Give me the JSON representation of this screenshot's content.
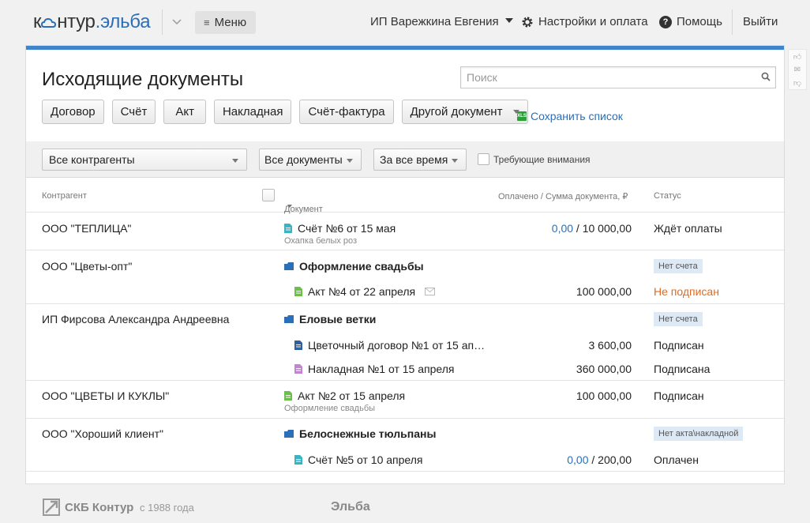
{
  "header": {
    "logo_left": "к",
    "logo_mid": "нтур",
    "logo_dot_elba": ".эльба",
    "menu_label": "Меню",
    "user_label": "ИП Варежкина Евгения",
    "settings_label": "Настройки и оплата",
    "help_label": "Помощь",
    "exit_label": "Выйти"
  },
  "page": {
    "title": "Исходящие документы",
    "search_placeholder": "Поиск"
  },
  "doc_buttons": [
    "Договор",
    "Счёт",
    "Акт",
    "Накладная",
    "Счёт-фактура"
  ],
  "other_doc_label": "Другой документ",
  "save_list_label": "Сохранить список",
  "filters": {
    "contractors": "Все контрагенты",
    "documents": "Все документы",
    "period": "За все время",
    "attention_label": "Требующие внимания"
  },
  "columns": {
    "contractor": "Контрагент",
    "document": "Документ",
    "amount": "Оплачено / Сумма документа, ₽",
    "status": "Статус"
  },
  "rows": [
    {
      "contractor": "ООО \"ТЕПЛИЦА\"",
      "doc": "Счёт №6 от 15 мая",
      "sub": "Охапка белых роз",
      "paid": "0,00",
      "sep": " / ",
      "total": "10 000,00",
      "status": "Ждёт оплаты"
    },
    {
      "contractor": "ООО \"Цветы-опт\"",
      "deal": "Оформление свадьбы",
      "deal_badge": "Нет счета",
      "doc": "Акт №4 от 22 апреля",
      "amount": "100 000,00",
      "status": "Не подписан"
    },
    {
      "contractor": "ИП Фирсова Александра Андреевна",
      "deal": "Еловые ветки",
      "deal_badge": "Нет счета",
      "doc1": "Цветочный договор №1 от 15 ап…",
      "amount1": "3 600,00",
      "status1": "Подписан",
      "doc2": "Накладная №1 от 15 апреля",
      "amount2": "360 000,00",
      "status2": "Подписана"
    },
    {
      "contractor": "ООО \"ЦВЕТЫ И КУКЛЫ\"",
      "doc": "Акт №2 от 15 апреля",
      "sub": "Оформление свадьбы",
      "amount": "100 000,00",
      "status": "Подписан"
    },
    {
      "contractor": "ООО \"Хороший клиент\"",
      "deal": "Белоснежные тюльпаны",
      "deal_badge": "Нет акта\\накладной",
      "doc": "Счёт №5 от 10 апреля",
      "paid": "0,00",
      "sep": " / ",
      "total": "200,00",
      "status": "Оплачен"
    }
  ],
  "footer": {
    "company": "СКБ Контур",
    "since": "с 1988 года",
    "product": "Эльба"
  },
  "colors": {
    "accent_blue": "#3d86cf",
    "link_blue": "#2a6fb8",
    "status_orange": "#e36a1b",
    "badge_bg": "#dde9f5",
    "invoice_icon": "#3bb3c3",
    "act_icon": "#6cc04a",
    "contract_icon": "#2f5f9e",
    "waybill_icon": "#c583d6",
    "deal_icon": "#2a6fb8"
  }
}
